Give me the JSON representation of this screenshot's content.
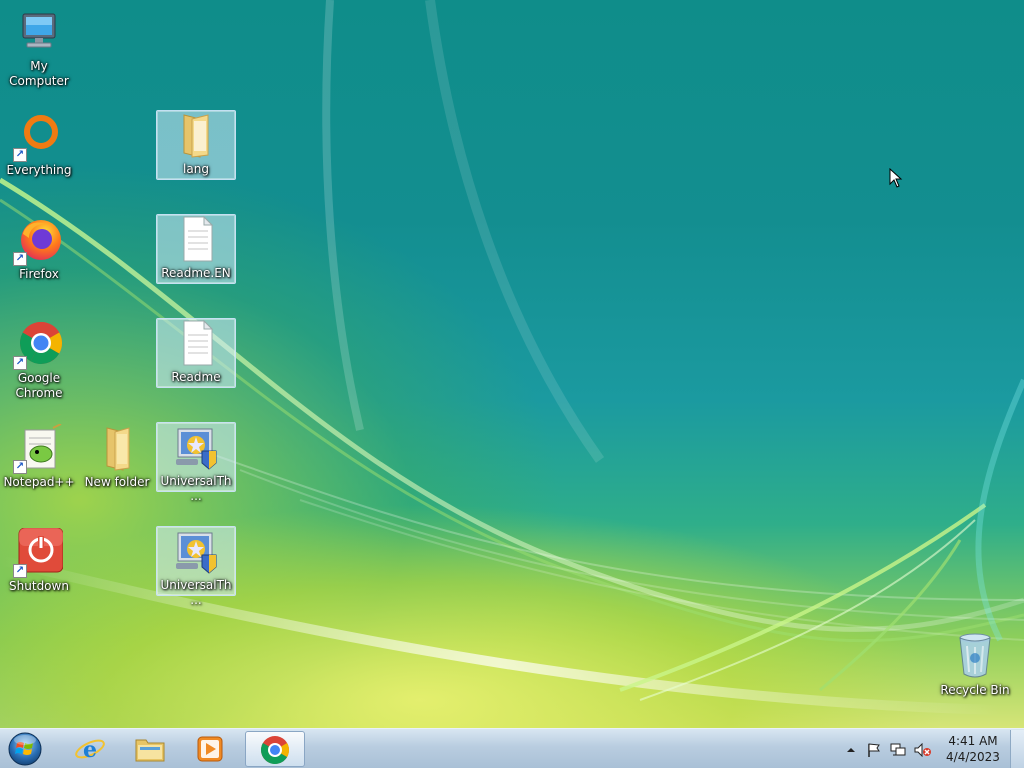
{
  "desktop": {
    "icons": {
      "my_computer": "My Computer",
      "everything": "Everything",
      "firefox": "Firefox",
      "chrome": "Google Chrome",
      "notepadpp": "Notepad++",
      "shutdown": "Shutdown",
      "new_folder": "New folder",
      "lang": "lang",
      "readme_en": "Readme.EN",
      "readme": "Readme",
      "universal1": "UniversalTh...",
      "universal2": "UniversalTh...",
      "recycle_bin": "Recycle Bin"
    }
  },
  "taskbar": {
    "pinned": [
      "start-orb",
      "internet-explorer-icon",
      "file-explorer-icon",
      "media-player-icon",
      "google-chrome-icon"
    ],
    "active_app": "Google Chrome",
    "tray_icons": [
      "show-hidden-icons-arrow",
      "action-center-flag-icon",
      "network-icon",
      "volume-muted-icon"
    ],
    "clock": {
      "time": "4:41 AM",
      "date": "4/4/2023"
    }
  },
  "colors": {
    "taskbar": "#b9cde0",
    "selection": "#d2ebfa"
  }
}
